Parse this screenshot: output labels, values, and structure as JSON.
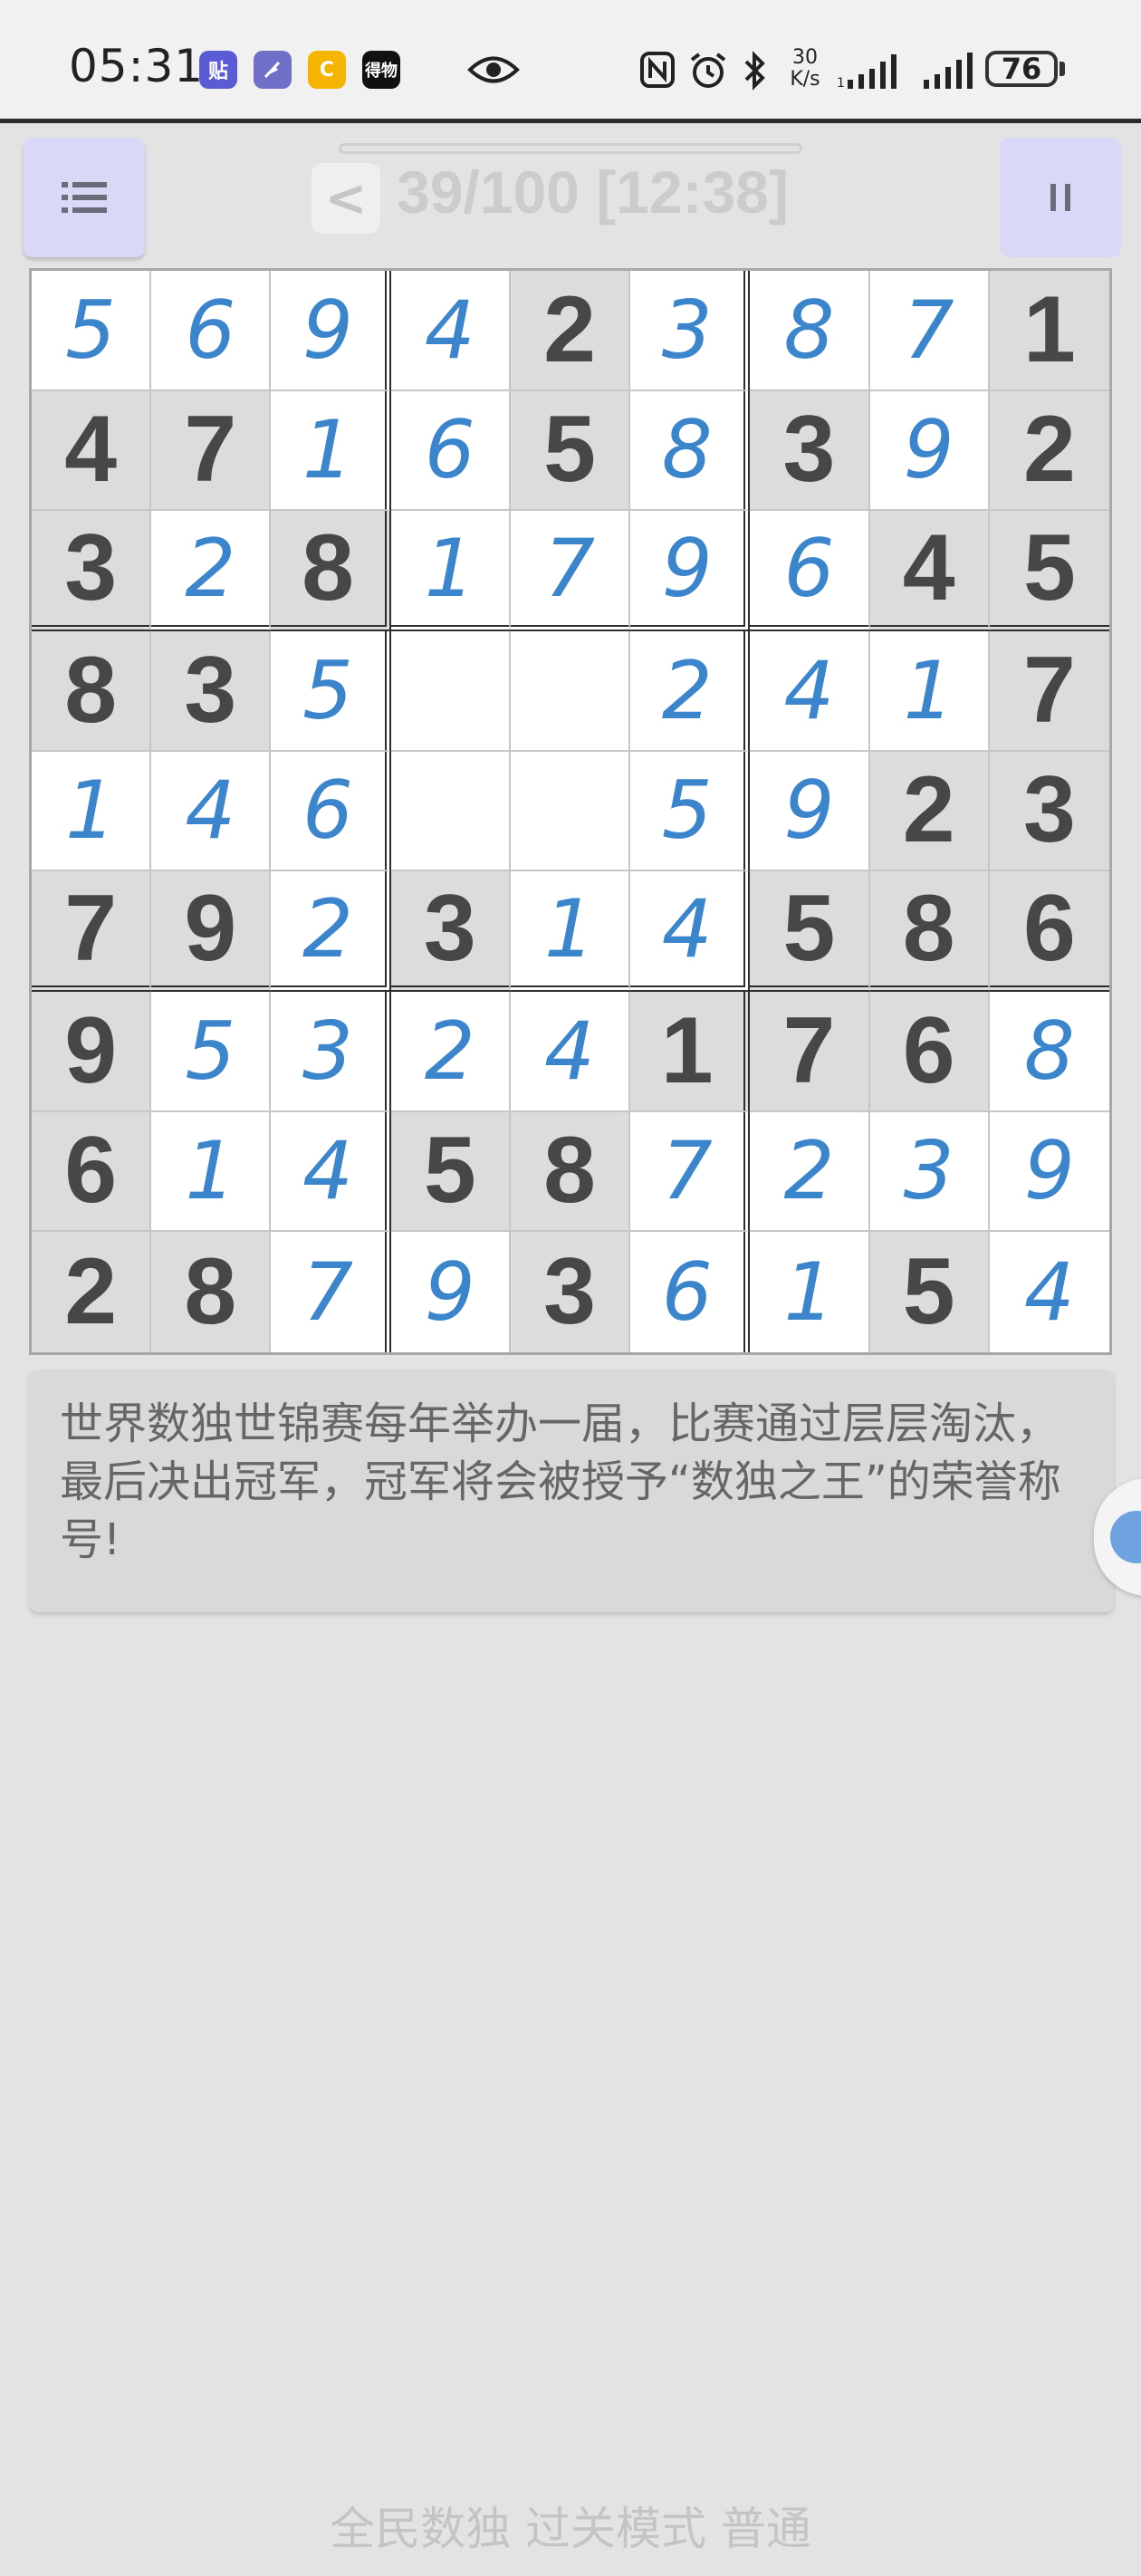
{
  "status_bar": {
    "time": "05:31",
    "net_speed_value": "30",
    "net_speed_unit": "K/s",
    "battery": "76",
    "app_icons": [
      {
        "name": "tieba-icon",
        "label": "贴",
        "color": "#5b5bd6"
      },
      {
        "name": "feather-app-icon",
        "label": "",
        "color": "#7070c8"
      },
      {
        "name": "orange-app-icon",
        "label": "C",
        "color": "#f4b400"
      },
      {
        "name": "dewu-app-icon",
        "label": "得物",
        "color": "#111111"
      }
    ]
  },
  "header": {
    "back_label": "<",
    "level_title": "39/100 [12:38]"
  },
  "board": {
    "rows": [
      [
        {
          "v": "5",
          "t": "filled"
        },
        {
          "v": "6",
          "t": "filled"
        },
        {
          "v": "9",
          "t": "filled"
        },
        {
          "v": "4",
          "t": "filled"
        },
        {
          "v": "2",
          "t": "given"
        },
        {
          "v": "3",
          "t": "filled"
        },
        {
          "v": "8",
          "t": "filled"
        },
        {
          "v": "7",
          "t": "filled"
        },
        {
          "v": "1",
          "t": "given"
        }
      ],
      [
        {
          "v": "4",
          "t": "given"
        },
        {
          "v": "7",
          "t": "given"
        },
        {
          "v": "1",
          "t": "filled"
        },
        {
          "v": "6",
          "t": "filled"
        },
        {
          "v": "5",
          "t": "given"
        },
        {
          "v": "8",
          "t": "filled"
        },
        {
          "v": "3",
          "t": "given"
        },
        {
          "v": "9",
          "t": "filled"
        },
        {
          "v": "2",
          "t": "given"
        }
      ],
      [
        {
          "v": "3",
          "t": "given"
        },
        {
          "v": "2",
          "t": "filled"
        },
        {
          "v": "8",
          "t": "given"
        },
        {
          "v": "1",
          "t": "filled"
        },
        {
          "v": "7",
          "t": "filled"
        },
        {
          "v": "9",
          "t": "filled"
        },
        {
          "v": "6",
          "t": "filled"
        },
        {
          "v": "4",
          "t": "given"
        },
        {
          "v": "5",
          "t": "given"
        }
      ],
      [
        {
          "v": "8",
          "t": "given"
        },
        {
          "v": "3",
          "t": "given"
        },
        {
          "v": "5",
          "t": "filled"
        },
        {
          "v": "",
          "t": "empty"
        },
        {
          "v": "",
          "t": "empty"
        },
        {
          "v": "2",
          "t": "filled"
        },
        {
          "v": "4",
          "t": "filled"
        },
        {
          "v": "1",
          "t": "filled"
        },
        {
          "v": "7",
          "t": "given"
        }
      ],
      [
        {
          "v": "1",
          "t": "filled"
        },
        {
          "v": "4",
          "t": "filled"
        },
        {
          "v": "6",
          "t": "filled"
        },
        {
          "v": "",
          "t": "empty"
        },
        {
          "v": "",
          "t": "empty"
        },
        {
          "v": "5",
          "t": "filled"
        },
        {
          "v": "9",
          "t": "filled"
        },
        {
          "v": "2",
          "t": "given"
        },
        {
          "v": "3",
          "t": "given"
        }
      ],
      [
        {
          "v": "7",
          "t": "given"
        },
        {
          "v": "9",
          "t": "given"
        },
        {
          "v": "2",
          "t": "filled"
        },
        {
          "v": "3",
          "t": "given"
        },
        {
          "v": "1",
          "t": "filled"
        },
        {
          "v": "4",
          "t": "filled"
        },
        {
          "v": "5",
          "t": "given"
        },
        {
          "v": "8",
          "t": "given"
        },
        {
          "v": "6",
          "t": "given"
        }
      ],
      [
        {
          "v": "9",
          "t": "given"
        },
        {
          "v": "5",
          "t": "filled"
        },
        {
          "v": "3",
          "t": "filled"
        },
        {
          "v": "2",
          "t": "filled"
        },
        {
          "v": "4",
          "t": "filled"
        },
        {
          "v": "1",
          "t": "given"
        },
        {
          "v": "7",
          "t": "given"
        },
        {
          "v": "6",
          "t": "given"
        },
        {
          "v": "8",
          "t": "filled"
        }
      ],
      [
        {
          "v": "6",
          "t": "given"
        },
        {
          "v": "1",
          "t": "filled"
        },
        {
          "v": "4",
          "t": "filled"
        },
        {
          "v": "5",
          "t": "given"
        },
        {
          "v": "8",
          "t": "given"
        },
        {
          "v": "7",
          "t": "filled"
        },
        {
          "v": "2",
          "t": "filled"
        },
        {
          "v": "3",
          "t": "filled"
        },
        {
          "v": "9",
          "t": "filled"
        }
      ],
      [
        {
          "v": "2",
          "t": "given"
        },
        {
          "v": "8",
          "t": "given"
        },
        {
          "v": "7",
          "t": "filled"
        },
        {
          "v": "9",
          "t": "filled"
        },
        {
          "v": "3",
          "t": "given"
        },
        {
          "v": "6",
          "t": "filled"
        },
        {
          "v": "1",
          "t": "filled"
        },
        {
          "v": "5",
          "t": "given"
        },
        {
          "v": "4",
          "t": "filled"
        }
      ]
    ]
  },
  "tip": {
    "text": "世界数独世锦赛每年举办一届，比赛通过层层淘汰，最后决出冠军，冠军将会被授予“数独之王”的荣誉称号!"
  },
  "footer": {
    "text": "全民数独 过关模式 普通"
  },
  "colors": {
    "filled_digit": "#3b85cc",
    "given_digit": "#474747",
    "button_bg": "#d9d9f7"
  }
}
